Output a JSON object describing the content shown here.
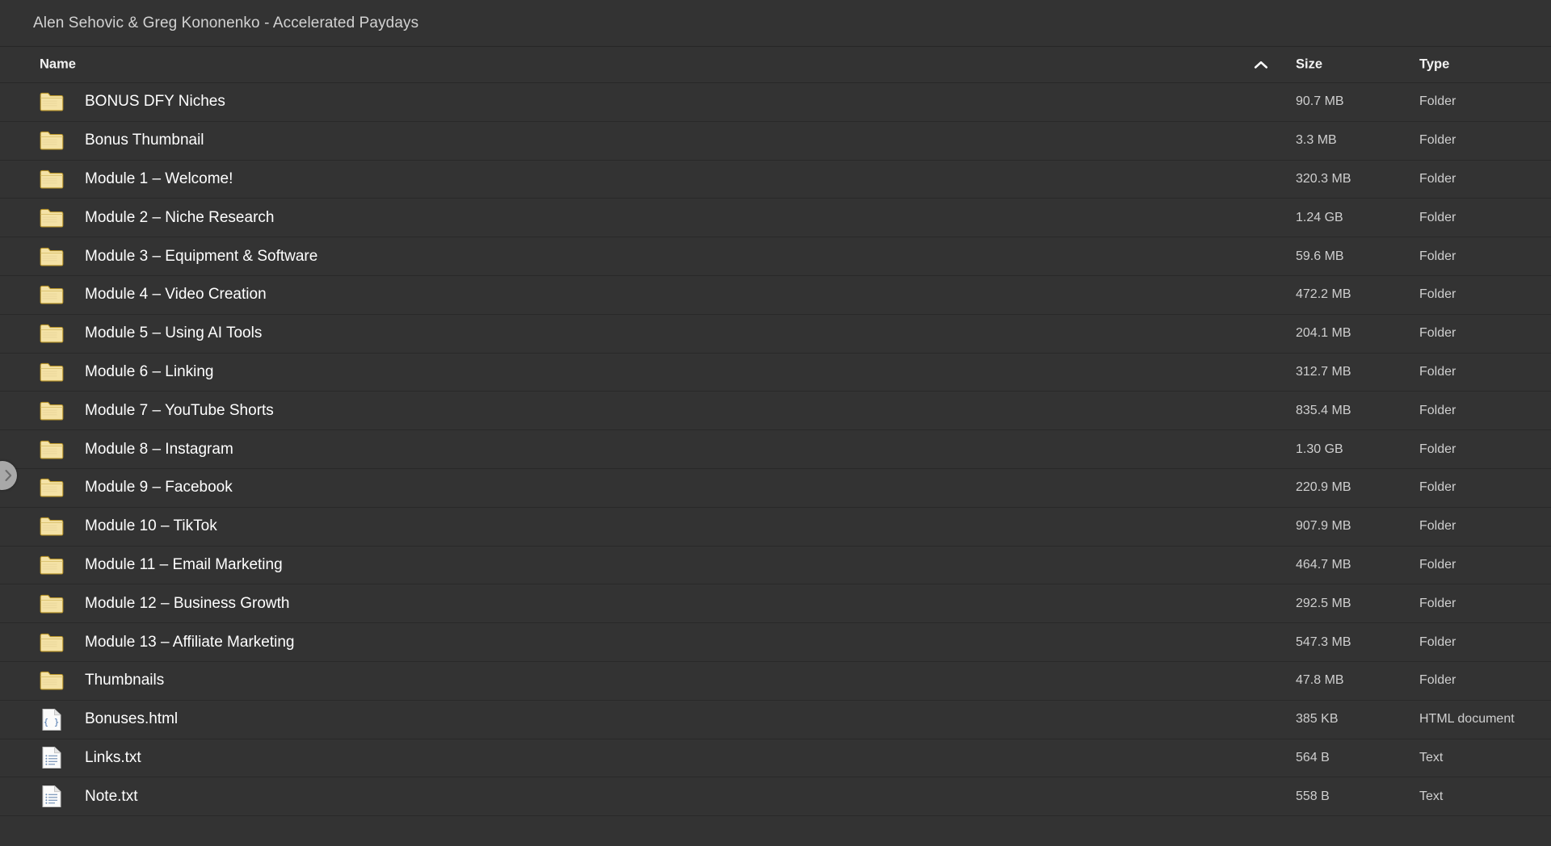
{
  "window": {
    "title": "Alen Sehovic & Greg Kononenko - Accelerated Paydays"
  },
  "columns": {
    "name": "Name",
    "size": "Size",
    "type": "Type",
    "sort_column": "Name",
    "sort_direction": "ascending",
    "sort_icon": "chevron-up-icon"
  },
  "drawer": {
    "handle_icon": "chevron-right-icon"
  },
  "colors": {
    "background": "#333333",
    "row_divider": "#292929",
    "text_primary": "#ffffff",
    "text_secondary": "#cfcfcf",
    "title_text": "#d2d2d2",
    "folder_icon": "#f2dfa0",
    "folder_icon_edge": "#c9a227",
    "file_icon_page": "#fafafa",
    "html_icon_accent": "#5b7fb0",
    "text_icon_accent": "#7a93b5",
    "handle_bg": "#a8a8a8"
  },
  "files": [
    {
      "name": "BONUS DFY Niches",
      "size": "90.7 MB",
      "type": "Folder",
      "icon": "folder-icon"
    },
    {
      "name": "Bonus Thumbnail",
      "size": "3.3 MB",
      "type": "Folder",
      "icon": "folder-icon"
    },
    {
      "name": "Module 1 – Welcome!",
      "size": "320.3 MB",
      "type": "Folder",
      "icon": "folder-icon"
    },
    {
      "name": "Module 2 – Niche Research",
      "size": "1.24 GB",
      "type": "Folder",
      "icon": "folder-icon"
    },
    {
      "name": "Module 3 – Equipment & Software",
      "size": "59.6 MB",
      "type": "Folder",
      "icon": "folder-icon"
    },
    {
      "name": "Module 4 – Video Creation",
      "size": "472.2 MB",
      "type": "Folder",
      "icon": "folder-icon"
    },
    {
      "name": "Module 5 – Using AI Tools",
      "size": "204.1 MB",
      "type": "Folder",
      "icon": "folder-icon"
    },
    {
      "name": "Module 6 – Linking",
      "size": "312.7 MB",
      "type": "Folder",
      "icon": "folder-icon"
    },
    {
      "name": "Module 7 – YouTube Shorts",
      "size": "835.4 MB",
      "type": "Folder",
      "icon": "folder-icon"
    },
    {
      "name": "Module 8 – Instagram",
      "size": "1.30 GB",
      "type": "Folder",
      "icon": "folder-icon"
    },
    {
      "name": "Module 9 – Facebook",
      "size": "220.9 MB",
      "type": "Folder",
      "icon": "folder-icon"
    },
    {
      "name": "Module 10 – TikTok",
      "size": "907.9 MB",
      "type": "Folder",
      "icon": "folder-icon"
    },
    {
      "name": "Module 11 – Email Marketing",
      "size": "464.7 MB",
      "type": "Folder",
      "icon": "folder-icon"
    },
    {
      "name": "Module 12 – Business Growth",
      "size": "292.5 MB",
      "type": "Folder",
      "icon": "folder-icon"
    },
    {
      "name": "Module 13 – Affiliate Marketing",
      "size": "547.3 MB",
      "type": "Folder",
      "icon": "folder-icon"
    },
    {
      "name": "Thumbnails",
      "size": "47.8 MB",
      "type": "Folder",
      "icon": "folder-icon"
    },
    {
      "name": "Bonuses.html",
      "size": "385 KB",
      "type": "HTML document",
      "icon": "html-file-icon"
    },
    {
      "name": "Links.txt",
      "size": "564 B",
      "type": "Text",
      "icon": "text-file-icon"
    },
    {
      "name": "Note.txt",
      "size": "558 B",
      "type": "Text",
      "icon": "text-file-icon"
    }
  ]
}
